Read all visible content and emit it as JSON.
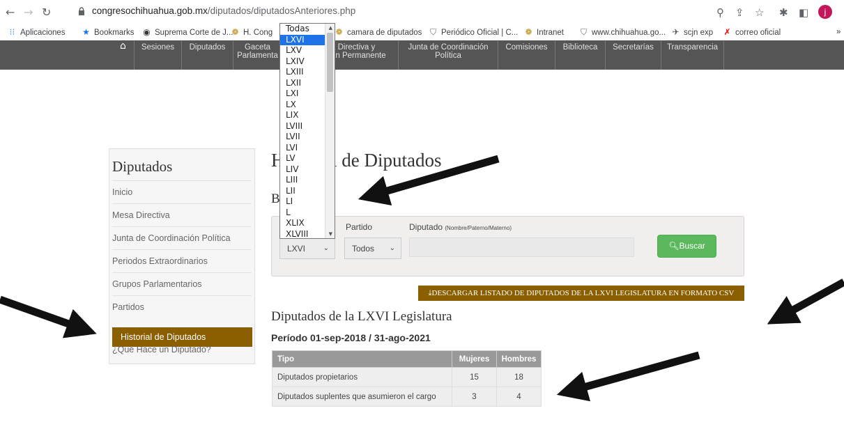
{
  "browser": {
    "url_domain": "congresochihuahua.gob.mx",
    "url_path": "/diputados/diputadosAnteriores.php",
    "profile_initial": "j"
  },
  "bookmarks": [
    "Aplicaciones",
    "Bookmarks",
    "Suprema Corte de J...",
    "H. Cong",
    "camara de diputados",
    "Periódico Oficial | C...",
    "Intranet",
    "www.chihuahua.go...",
    "scjn exp",
    "correo oficial"
  ],
  "sitenav": {
    "items": [
      {
        "l1": "Sesiones",
        "l2": ""
      },
      {
        "l1": "Diputados",
        "l2": ""
      },
      {
        "l1": "Gaceta",
        "l2": "Parlamenta"
      },
      {
        "l1": "a Directiva y",
        "l2": "ón Permanente"
      },
      {
        "l1": "Junta de Coordinación",
        "l2": "Política"
      },
      {
        "l1": "Comisiones",
        "l2": ""
      },
      {
        "l1": "Biblioteca",
        "l2": ""
      },
      {
        "l1": "Secretarías",
        "l2": ""
      },
      {
        "l1": "Transparencia",
        "l2": ""
      }
    ]
  },
  "dropdown": {
    "options": [
      "Todas",
      "LXVI",
      "LXV",
      "LXIV",
      "LXIII",
      "LXII",
      "LXI",
      "LX",
      "LIX",
      "LVIII",
      "LVII",
      "LVI",
      "LV",
      "LIV",
      "LIII",
      "LII",
      "LI",
      "L",
      "XLIX",
      "XLVIII"
    ],
    "selected": "LXVI"
  },
  "sidebar": {
    "title": "Diputados",
    "items": [
      "Inicio",
      "Mesa Directiva",
      "Junta de Coordinación Política",
      "Periodos Extraordinarios",
      "Grupos Parlamentarios",
      "Partidos"
    ],
    "active": "Historial de Diputados",
    "last": "¿Qué Hace un Diputado?"
  },
  "main": {
    "title": "Historial de Diputados",
    "search_title": "B",
    "partido_label": "Partido",
    "diputado_label": "Diputado",
    "diputado_hint": "(Nombre/Paterno/Materno)",
    "legislatura_value": "LXVI",
    "partido_value": "Todos",
    "buscar_label": "Buscar",
    "csv_label": "DESCARGAR LISTADO DE DIPUTADOS DE LA LXVI LEGISLATURA EN FORMATO CSV",
    "legislatura_title": "Diputados de la LXVI Legislatura",
    "period": "Período 01-sep-2018 / 31-ago-2021"
  },
  "table": {
    "headers": [
      "Tipo",
      "Mujeres",
      "Hombres"
    ],
    "rows": [
      [
        "Diputados propietarios",
        "15",
        "18"
      ],
      [
        "Diputados suplentes que asumieron el cargo",
        "3",
        "4"
      ]
    ]
  }
}
